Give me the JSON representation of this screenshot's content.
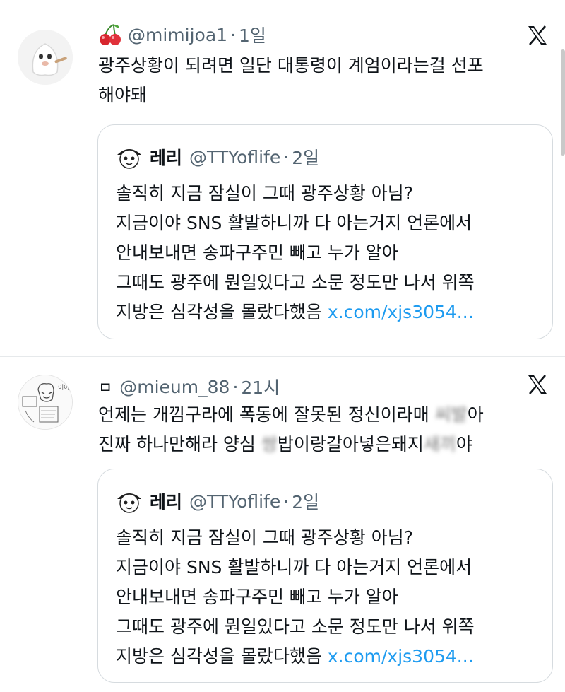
{
  "tweets": [
    {
      "handle": "@mimijoa1",
      "time": "1일",
      "lines": [
        "광주상황이 되려면 일단 대통령이 계엄이라는걸 선포",
        "해야돼"
      ],
      "quote": {
        "name": "레리",
        "handle": "@TTYoflife",
        "time": "2일",
        "lines": [
          "솔직히 지금 잠실이 그때 광주상황 아님?",
          "지금이야 SNS 활발하니까 다 아는거지 언론에서",
          "안내보내면 송파구주민 빼고 누가 알아",
          "그때도 광주에 뭔일있다고 소문 정도만 나서 위쪽"
        ],
        "last_line_text": "지방은 심각성을 몰랐다했음",
        "link": "x.com/xjs3054..."
      }
    },
    {
      "badge": "ㅁ",
      "handle": "@mieum_88",
      "time": "21시",
      "line1_text": "언제는 개낌구라에 폭동에 잘못된 정신이라매",
      "line1_blurred": "씨발",
      "line1_tail": "아",
      "line2_pre": "진짜 하나만해라 양심",
      "line2_blur_a": "쌍",
      "line2_mid": "밥이랑갈아넣은돼지",
      "line2_blur_b": "새끼",
      "line2_tail": "야",
      "quote": {
        "name": "레리",
        "handle": "@TTYoflife",
        "time": "2일",
        "lines": [
          "솔직히 지금 잠실이 그때 광주상황 아님?",
          "지금이야 SNS 활발하니까 다 아는거지 언론에서",
          "안내보내면 송파구주민 빼고 누가 알아",
          "그때도 광주에 뭔일있다고 소문 정도만 나서 위쪽"
        ],
        "last_line_text": "지방은 심각성을 몰랐다했음",
        "link": "x.com/xjs3054..."
      }
    }
  ],
  "icons": {
    "platform": "x-logo-icon",
    "emoji": "cherry-icon"
  },
  "colors": {
    "link": "#1d9bf0",
    "muted": "#536471",
    "border": "#d6dbdf"
  }
}
